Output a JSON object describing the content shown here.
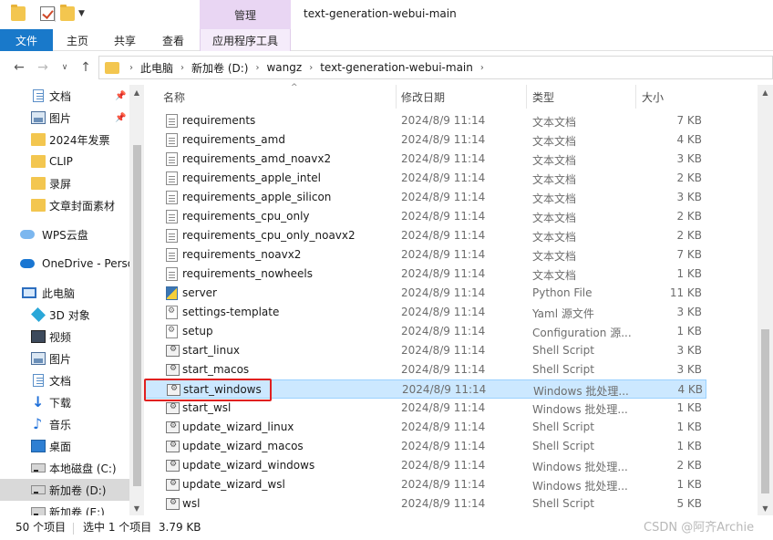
{
  "window": {
    "title": "text-generation-webui-main",
    "context_tab": "管理"
  },
  "ribbon": {
    "tabs": [
      "文件",
      "主页",
      "共享",
      "查看",
      "应用程序工具"
    ]
  },
  "address": {
    "crumbs": [
      "此电脑",
      "新加卷 (D:)",
      "wangz",
      "text-generation-webui-main"
    ]
  },
  "nav": {
    "items": [
      {
        "label": "文档",
        "icon": "documents-icon",
        "pinned": true
      },
      {
        "label": "图片",
        "icon": "pictures-icon",
        "pinned": true
      },
      {
        "label": "2024年发票",
        "icon": "folder-icon",
        "pinned": false
      },
      {
        "label": "CLIP",
        "icon": "folder-icon",
        "pinned": false
      },
      {
        "label": "录屏",
        "icon": "folder-icon",
        "pinned": false
      },
      {
        "label": "文章封面素材",
        "icon": "folder-icon",
        "pinned": false
      },
      {
        "label": "WPS云盘",
        "icon": "cloud-icon",
        "pinned": false
      },
      {
        "label": "OneDrive - Perso",
        "icon": "onedrive-icon",
        "pinned": false
      },
      {
        "label": "此电脑",
        "icon": "pc-icon",
        "pinned": false
      },
      {
        "label": "3D 对象",
        "icon": "3d-objects-icon",
        "pinned": false
      },
      {
        "label": "视频",
        "icon": "videos-icon",
        "pinned": false
      },
      {
        "label": "图片",
        "icon": "pictures-icon",
        "pinned": false
      },
      {
        "label": "文档",
        "icon": "documents-icon",
        "pinned": false
      },
      {
        "label": "下载",
        "icon": "downloads-icon",
        "pinned": false
      },
      {
        "label": "音乐",
        "icon": "music-icon",
        "pinned": false
      },
      {
        "label": "桌面",
        "icon": "desktop-icon",
        "pinned": false
      },
      {
        "label": "本地磁盘 (C:)",
        "icon": "drive-icon",
        "pinned": false
      },
      {
        "label": "新加卷 (D:)",
        "icon": "drive-icon",
        "pinned": false
      },
      {
        "label": "新加卷 (E:)",
        "icon": "drive-icon",
        "pinned": false
      }
    ]
  },
  "columns": {
    "name": "名称",
    "date": "修改日期",
    "type": "类型",
    "size": "大小"
  },
  "files": [
    {
      "name": "requirements",
      "date": "2024/8/9 11:14",
      "type": "文本文档",
      "size": "7 KB",
      "icon": "txt"
    },
    {
      "name": "requirements_amd",
      "date": "2024/8/9 11:14",
      "type": "文本文档",
      "size": "4 KB",
      "icon": "txt"
    },
    {
      "name": "requirements_amd_noavx2",
      "date": "2024/8/9 11:14",
      "type": "文本文档",
      "size": "3 KB",
      "icon": "txt"
    },
    {
      "name": "requirements_apple_intel",
      "date": "2024/8/9 11:14",
      "type": "文本文档",
      "size": "2 KB",
      "icon": "txt"
    },
    {
      "name": "requirements_apple_silicon",
      "date": "2024/8/9 11:14",
      "type": "文本文档",
      "size": "3 KB",
      "icon": "txt"
    },
    {
      "name": "requirements_cpu_only",
      "date": "2024/8/9 11:14",
      "type": "文本文档",
      "size": "2 KB",
      "icon": "txt"
    },
    {
      "name": "requirements_cpu_only_noavx2",
      "date": "2024/8/9 11:14",
      "type": "文本文档",
      "size": "2 KB",
      "icon": "txt"
    },
    {
      "name": "requirements_noavx2",
      "date": "2024/8/9 11:14",
      "type": "文本文档",
      "size": "7 KB",
      "icon": "txt"
    },
    {
      "name": "requirements_nowheels",
      "date": "2024/8/9 11:14",
      "type": "文本文档",
      "size": "1 KB",
      "icon": "txt"
    },
    {
      "name": "server",
      "date": "2024/8/9 11:14",
      "type": "Python File",
      "size": "11 KB",
      "icon": "py"
    },
    {
      "name": "settings-template",
      "date": "2024/8/9 11:14",
      "type": "Yaml 源文件",
      "size": "3 KB",
      "icon": "cfg"
    },
    {
      "name": "setup",
      "date": "2024/8/9 11:14",
      "type": "Configuration 源...",
      "size": "1 KB",
      "icon": "cfg"
    },
    {
      "name": "start_linux",
      "date": "2024/8/9 11:14",
      "type": "Shell Script",
      "size": "3 KB",
      "icon": "sh"
    },
    {
      "name": "start_macos",
      "date": "2024/8/9 11:14",
      "type": "Shell Script",
      "size": "3 KB",
      "icon": "sh"
    },
    {
      "name": "start_windows",
      "date": "2024/8/9 11:14",
      "type": "Windows 批处理...",
      "size": "4 KB",
      "icon": "sh"
    },
    {
      "name": "start_wsl",
      "date": "2024/8/9 11:14",
      "type": "Windows 批处理...",
      "size": "1 KB",
      "icon": "sh"
    },
    {
      "name": "update_wizard_linux",
      "date": "2024/8/9 11:14",
      "type": "Shell Script",
      "size": "1 KB",
      "icon": "sh"
    },
    {
      "name": "update_wizard_macos",
      "date": "2024/8/9 11:14",
      "type": "Shell Script",
      "size": "1 KB",
      "icon": "sh"
    },
    {
      "name": "update_wizard_windows",
      "date": "2024/8/9 11:14",
      "type": "Windows 批处理...",
      "size": "2 KB",
      "icon": "sh"
    },
    {
      "name": "update_wizard_wsl",
      "date": "2024/8/9 11:14",
      "type": "Windows 批处理...",
      "size": "1 KB",
      "icon": "sh"
    },
    {
      "name": "wsl",
      "date": "2024/8/9 11:14",
      "type": "Shell Script",
      "size": "5 KB",
      "icon": "sh"
    }
  ],
  "status": {
    "count": "50 个项目",
    "selection": "选中 1 个项目  3.79 KB"
  },
  "watermark": "CSDN @阿齐Archie"
}
